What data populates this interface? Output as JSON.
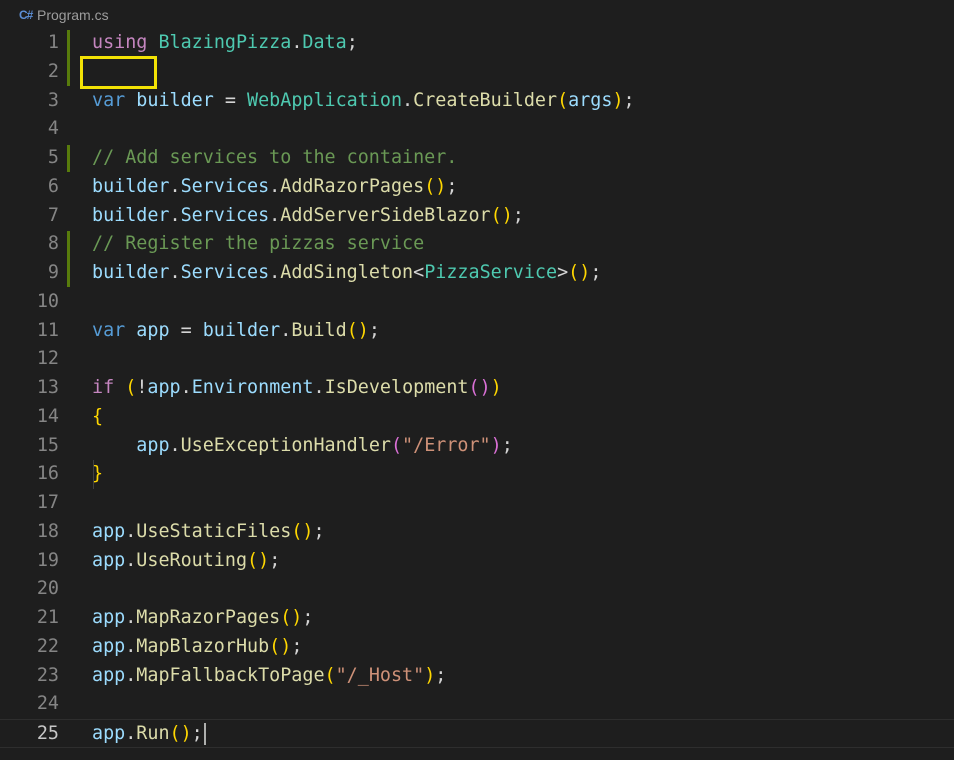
{
  "tab": {
    "icon": "csharp-file-icon",
    "icon_glyph": "C#",
    "filename": "Program.cs"
  },
  "editor": {
    "active_line": 25,
    "highlighted_token": "using",
    "line_numbers": [
      "1",
      "2",
      "3",
      "4",
      "5",
      "6",
      "7",
      "8",
      "9",
      "10",
      "11",
      "12",
      "13",
      "14",
      "15",
      "16",
      "17",
      "18",
      "19",
      "20",
      "21",
      "22",
      "23",
      "24",
      "25"
    ],
    "lines": [
      [
        {
          "t": "using",
          "c": "kw"
        },
        {
          "t": " ",
          "c": "pl"
        },
        {
          "t": "BlazingPizza",
          "c": "ty"
        },
        {
          "t": ".",
          "c": "pl"
        },
        {
          "t": "Data",
          "c": "ty"
        },
        {
          "t": ";",
          "c": "pl"
        }
      ],
      [],
      [
        {
          "t": "var",
          "c": "kwb"
        },
        {
          "t": " ",
          "c": "pl"
        },
        {
          "t": "builder",
          "c": "var"
        },
        {
          "t": " = ",
          "c": "pl"
        },
        {
          "t": "WebApplication",
          "c": "ty"
        },
        {
          "t": ".",
          "c": "pl"
        },
        {
          "t": "CreateBuilder",
          "c": "fn"
        },
        {
          "t": "(",
          "c": "p1"
        },
        {
          "t": "args",
          "c": "var"
        },
        {
          "t": ")",
          "c": "p1"
        },
        {
          "t": ";",
          "c": "pl"
        }
      ],
      [],
      [
        {
          "t": "// Add services to the container.",
          "c": "cm"
        }
      ],
      [
        {
          "t": "builder",
          "c": "var"
        },
        {
          "t": ".",
          "c": "pl"
        },
        {
          "t": "Services",
          "c": "var"
        },
        {
          "t": ".",
          "c": "pl"
        },
        {
          "t": "AddRazorPages",
          "c": "fn"
        },
        {
          "t": "()",
          "c": "p1"
        },
        {
          "t": ";",
          "c": "pl"
        }
      ],
      [
        {
          "t": "builder",
          "c": "var"
        },
        {
          "t": ".",
          "c": "pl"
        },
        {
          "t": "Services",
          "c": "var"
        },
        {
          "t": ".",
          "c": "pl"
        },
        {
          "t": "AddServerSideBlazor",
          "c": "fn"
        },
        {
          "t": "()",
          "c": "p1"
        },
        {
          "t": ";",
          "c": "pl"
        }
      ],
      [
        {
          "t": "// Register the pizzas service",
          "c": "cm"
        }
      ],
      [
        {
          "t": "builder",
          "c": "var"
        },
        {
          "t": ".",
          "c": "pl"
        },
        {
          "t": "Services",
          "c": "var"
        },
        {
          "t": ".",
          "c": "pl"
        },
        {
          "t": "AddSingleton",
          "c": "fn"
        },
        {
          "t": "<",
          "c": "pl"
        },
        {
          "t": "PizzaService",
          "c": "ty"
        },
        {
          "t": ">",
          "c": "pl"
        },
        {
          "t": "()",
          "c": "p1"
        },
        {
          "t": ";",
          "c": "pl"
        }
      ],
      [],
      [
        {
          "t": "var",
          "c": "kwb"
        },
        {
          "t": " ",
          "c": "pl"
        },
        {
          "t": "app",
          "c": "var"
        },
        {
          "t": " = ",
          "c": "pl"
        },
        {
          "t": "builder",
          "c": "var"
        },
        {
          "t": ".",
          "c": "pl"
        },
        {
          "t": "Build",
          "c": "fn"
        },
        {
          "t": "()",
          "c": "p1"
        },
        {
          "t": ";",
          "c": "pl"
        }
      ],
      [],
      [
        {
          "t": "if",
          "c": "kw"
        },
        {
          "t": " ",
          "c": "pl"
        },
        {
          "t": "(",
          "c": "p1"
        },
        {
          "t": "!",
          "c": "pl"
        },
        {
          "t": "app",
          "c": "var"
        },
        {
          "t": ".",
          "c": "pl"
        },
        {
          "t": "Environment",
          "c": "var"
        },
        {
          "t": ".",
          "c": "pl"
        },
        {
          "t": "IsDevelopment",
          "c": "fn"
        },
        {
          "t": "()",
          "c": "p2"
        },
        {
          "t": ")",
          "c": "p1"
        }
      ],
      [
        {
          "t": "{",
          "c": "p1"
        }
      ],
      [
        {
          "t": "    ",
          "c": "pl"
        },
        {
          "t": "app",
          "c": "var"
        },
        {
          "t": ".",
          "c": "pl"
        },
        {
          "t": "UseExceptionHandler",
          "c": "fn"
        },
        {
          "t": "(",
          "c": "p2"
        },
        {
          "t": "\"/Error\"",
          "c": "str"
        },
        {
          "t": ")",
          "c": "p2"
        },
        {
          "t": ";",
          "c": "pl"
        }
      ],
      [
        {
          "t": "}",
          "c": "p1"
        }
      ],
      [],
      [
        {
          "t": "app",
          "c": "var"
        },
        {
          "t": ".",
          "c": "pl"
        },
        {
          "t": "UseStaticFiles",
          "c": "fn"
        },
        {
          "t": "()",
          "c": "p1"
        },
        {
          "t": ";",
          "c": "pl"
        }
      ],
      [
        {
          "t": "app",
          "c": "var"
        },
        {
          "t": ".",
          "c": "pl"
        },
        {
          "t": "UseRouting",
          "c": "fn"
        },
        {
          "t": "()",
          "c": "p1"
        },
        {
          "t": ";",
          "c": "pl"
        }
      ],
      [],
      [
        {
          "t": "app",
          "c": "var"
        },
        {
          "t": ".",
          "c": "pl"
        },
        {
          "t": "MapRazorPages",
          "c": "fn"
        },
        {
          "t": "()",
          "c": "p1"
        },
        {
          "t": ";",
          "c": "pl"
        }
      ],
      [
        {
          "t": "app",
          "c": "var"
        },
        {
          "t": ".",
          "c": "pl"
        },
        {
          "t": "MapBlazorHub",
          "c": "fn"
        },
        {
          "t": "()",
          "c": "p1"
        },
        {
          "t": ";",
          "c": "pl"
        }
      ],
      [
        {
          "t": "app",
          "c": "var"
        },
        {
          "t": ".",
          "c": "pl"
        },
        {
          "t": "MapFallbackToPage",
          "c": "fn"
        },
        {
          "t": "(",
          "c": "p1"
        },
        {
          "t": "\"/_Host\"",
          "c": "str"
        },
        {
          "t": ")",
          "c": "p1"
        },
        {
          "t": ";",
          "c": "pl"
        }
      ],
      [],
      [
        {
          "t": "app",
          "c": "var"
        },
        {
          "t": ".",
          "c": "pl"
        },
        {
          "t": "Run",
          "c": "fn"
        },
        {
          "t": "()",
          "c": "p1"
        },
        {
          "t": ";",
          "c": "pl"
        }
      ]
    ],
    "modified_line_ranges": [
      [
        1,
        2
      ],
      [
        5,
        5
      ],
      [
        8,
        9
      ]
    ]
  }
}
